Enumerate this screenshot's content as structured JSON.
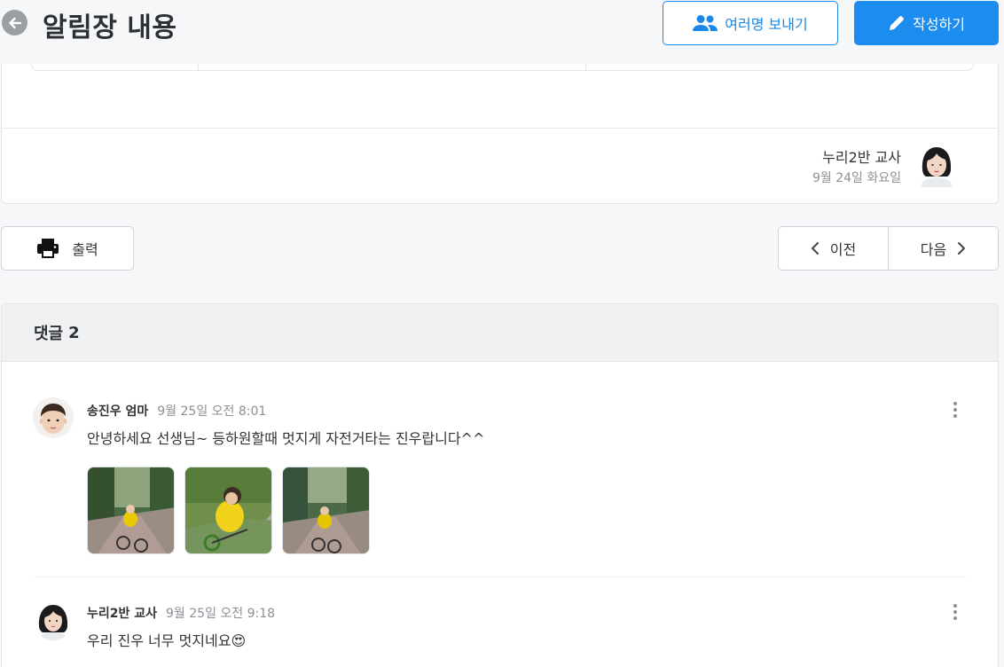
{
  "header": {
    "title": "알림장 내용",
    "multi_send_label": "여러명 보내기",
    "write_label": "작성하기"
  },
  "notice": {
    "author": "누리2반 교사",
    "date": "9월 24일 화요일"
  },
  "actions": {
    "print_label": "출력",
    "prev_label": "이전",
    "next_label": "다음"
  },
  "comments": {
    "header_label": "댓글",
    "count": "2",
    "items": [
      {
        "author": "송진우 엄마",
        "time": "9월 25일 오전 8:01",
        "text": "안녕하세요 선생님~ 등하원할때 멋지게 자전거타는 진우랍니다^^",
        "photo_count": 3
      },
      {
        "author": "누리2반 교사",
        "time": "9월 25일 오전 9:18",
        "text": "우리 진우 너무 멋지네요",
        "emoji": "😍"
      }
    ]
  },
  "colors": {
    "primary": "#1d8cef",
    "background": "#f6f7f9",
    "muted_text": "#8c9096"
  }
}
